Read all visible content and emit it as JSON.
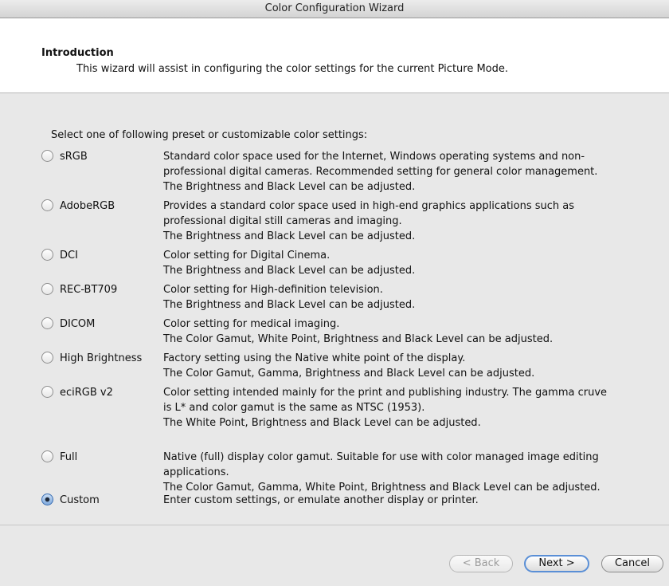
{
  "window": {
    "title": "Color Configuration Wizard"
  },
  "intro": {
    "title": "Introduction",
    "description": "This wizard will assist in configuring the color settings for the current Picture Mode."
  },
  "prompt": "Select one of following preset or customizable color settings:",
  "options": [
    {
      "label": "sRGB",
      "selected": false,
      "lines": [
        "Standard color space used for the Internet, Windows operating systems and non-",
        "professional digital cameras. Recommended setting for general color management.",
        "The Brightness and Black Level can be adjusted."
      ]
    },
    {
      "label": "AdobeRGB",
      "selected": false,
      "lines": [
        "Provides a standard color space used in high-end graphics applications such as",
        "professional digital still cameras and imaging.",
        "The Brightness and Black Level can be adjusted."
      ]
    },
    {
      "label": "DCI",
      "selected": false,
      "lines": [
        "Color setting for Digital Cinema.",
        "The Brightness and Black Level can be adjusted."
      ]
    },
    {
      "label": "REC-BT709",
      "selected": false,
      "lines": [
        "Color setting for High-definition television.",
        "The Brightness and Black Level can be adjusted."
      ]
    },
    {
      "label": "DICOM",
      "selected": false,
      "lines": [
        "Color setting for medical imaging.",
        "The Color Gamut, White Point, Brightness and Black Level can be adjusted."
      ]
    },
    {
      "label": "High Brightness",
      "selected": false,
      "lines": [
        "Factory setting using the Native white point of the display.",
        "The Color Gamut, Gamma, Brightness and Black Level can be adjusted."
      ]
    },
    {
      "label": "eciRGB v2",
      "selected": false,
      "lines": [
        "Color setting intended mainly for the print and publishing industry. The gamma cruve",
        "is L* and color gamut is the same as NTSC (1953).",
        "The White Point, Brightness and Black Level can be adjusted."
      ]
    },
    {
      "label": "Full",
      "selected": false,
      "lines": [
        "Native (full) display color gamut. Suitable for use with color managed image editing",
        "applications.",
        "The Color Gamut, Gamma, White Point, Brightness and Black Level can be adjusted."
      ]
    },
    {
      "label": "Custom",
      "selected": true,
      "lines": [
        "Enter custom settings, or emulate another display or printer."
      ]
    }
  ],
  "buttons": {
    "back": "< Back",
    "next": "Next >",
    "cancel": "Cancel"
  }
}
